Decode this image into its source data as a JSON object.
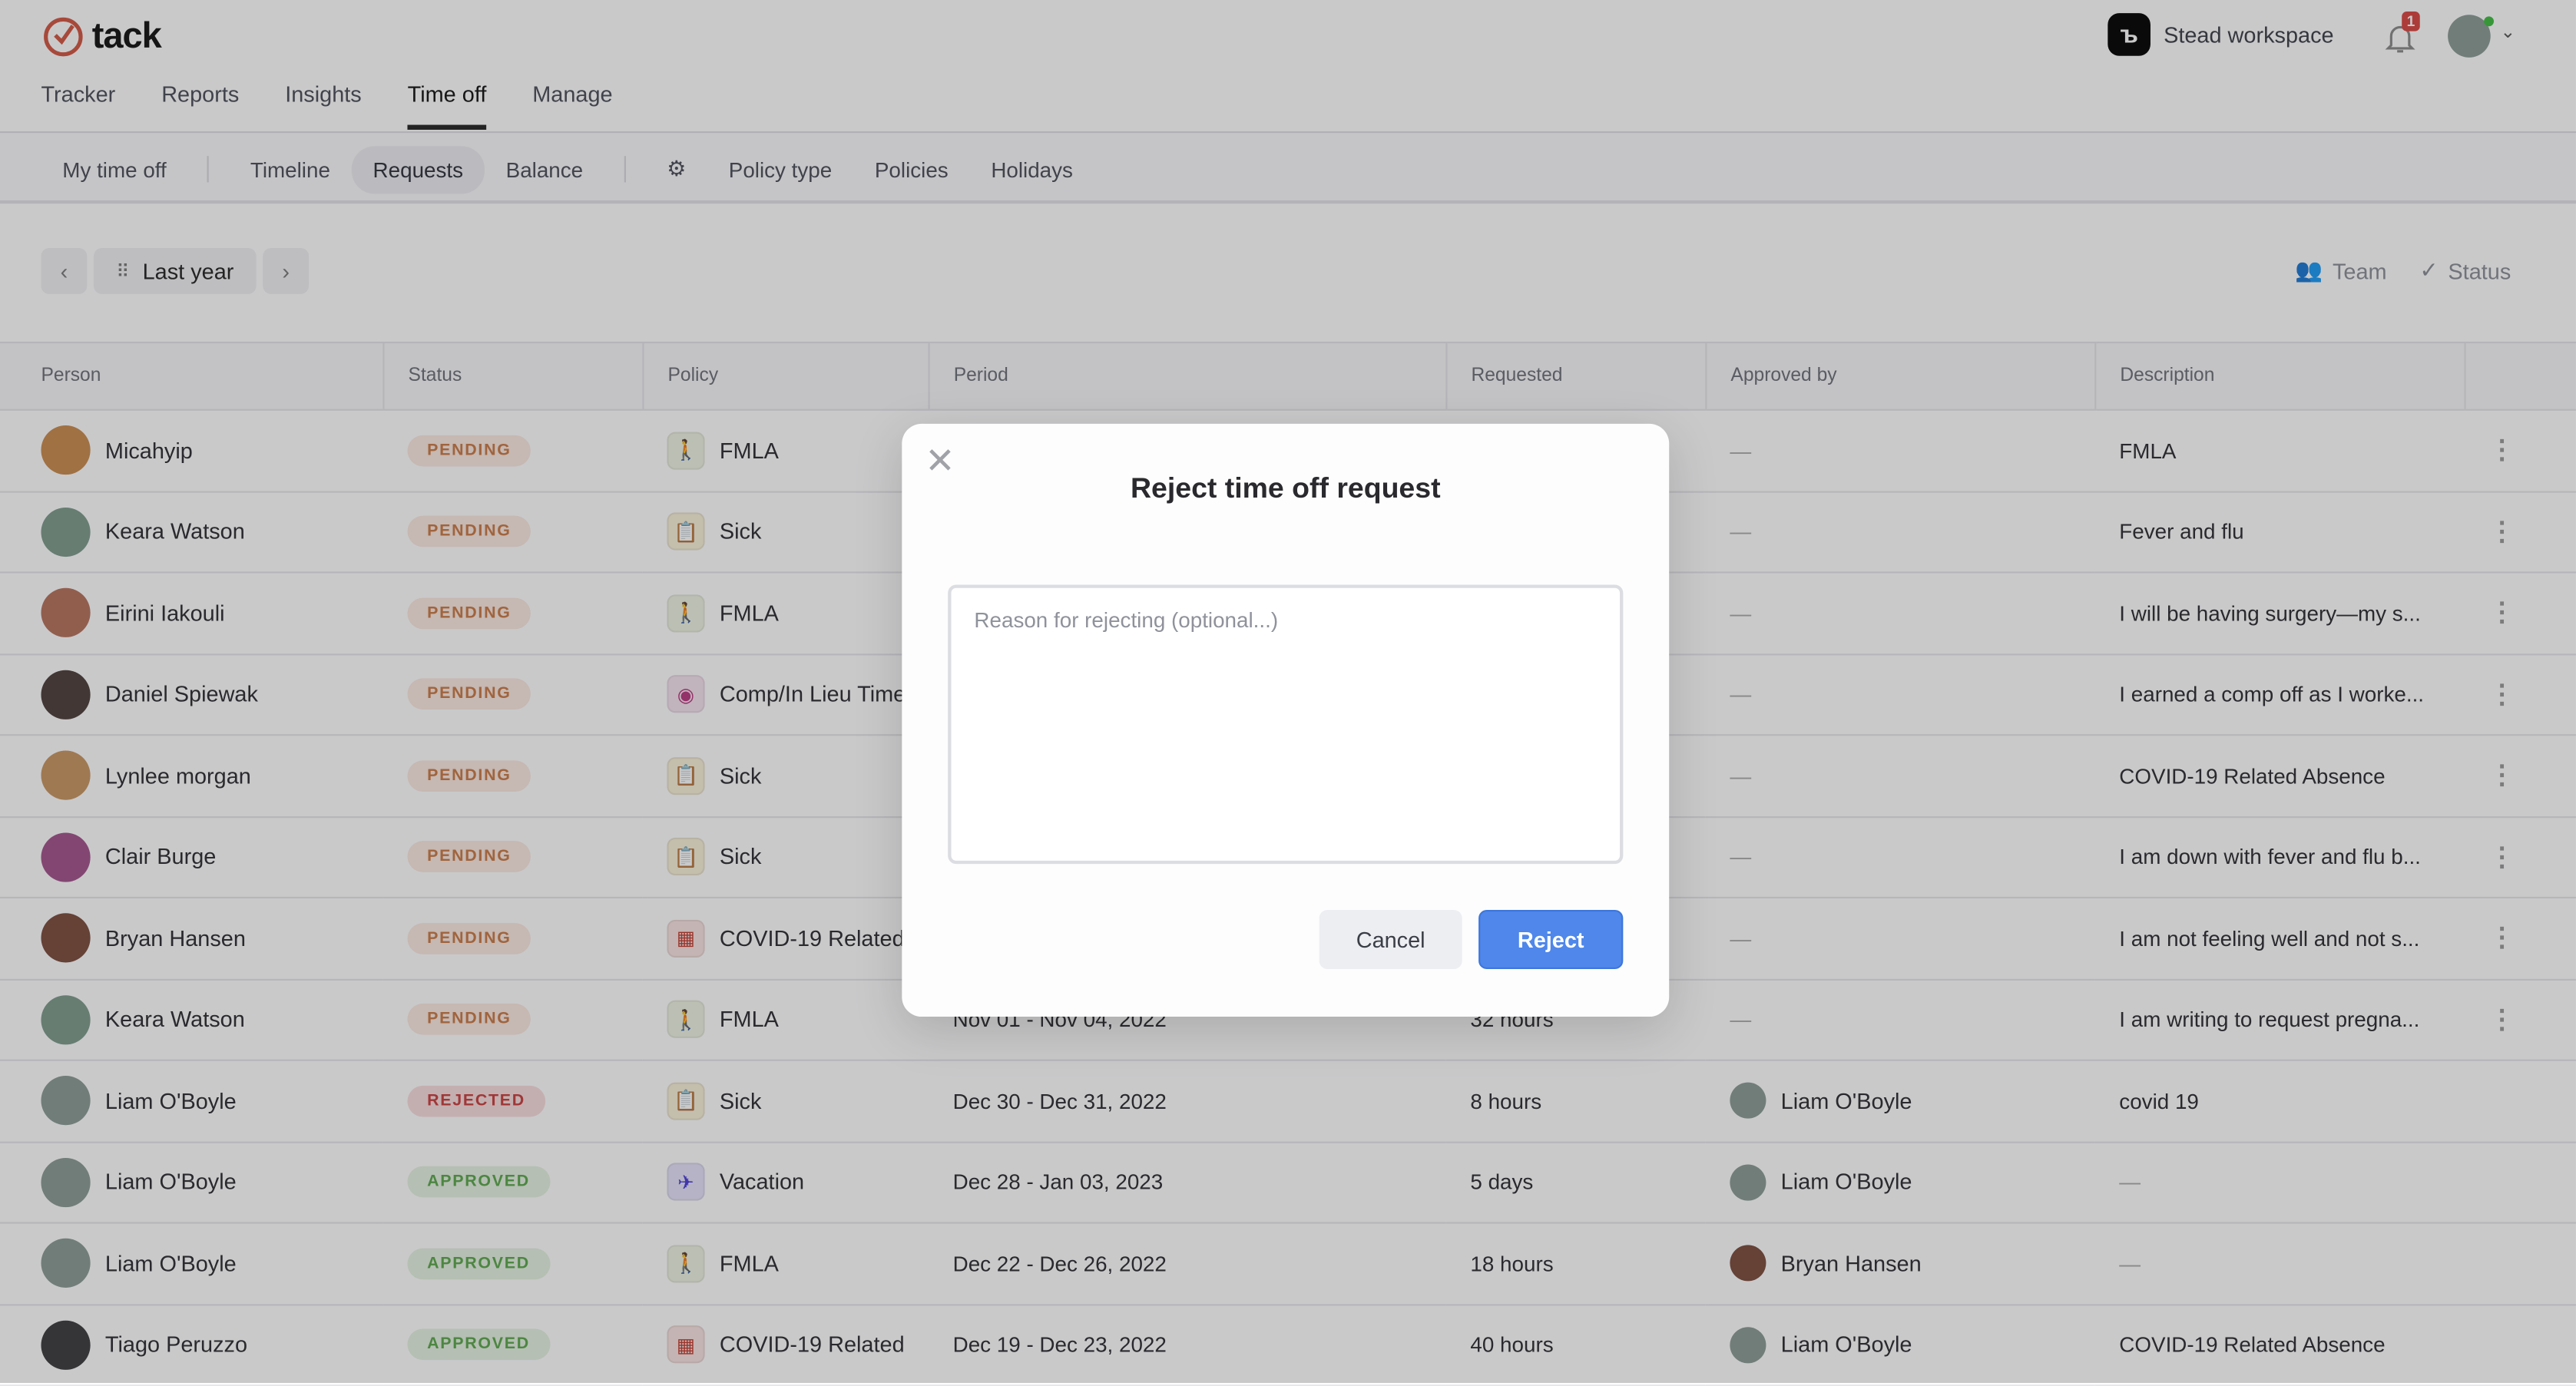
{
  "app": {
    "name": "tack",
    "workspace": "Stead workspace",
    "notifications": "1",
    "accent": "#4f87ea",
    "brand": "#d2553f"
  },
  "nav": [
    {
      "label": "Tracker"
    },
    {
      "label": "Reports"
    },
    {
      "label": "Insights"
    },
    {
      "label": "Time off",
      "active": true
    },
    {
      "label": "Manage"
    }
  ],
  "subnav": {
    "my_time_off": "My time off",
    "timeline": "Timeline",
    "requests": "Requests",
    "balance": "Balance",
    "policy_type": "Policy type",
    "policies": "Policies",
    "holidays": "Holidays"
  },
  "toolbar": {
    "range": "Last year",
    "team": "Team",
    "status": "Status"
  },
  "columns": [
    "Person",
    "Status",
    "Policy",
    "Period",
    "Requested",
    "Approved by",
    "Description"
  ],
  "rows": [
    {
      "person": "Micahyip",
      "avatar": "#c98a4b",
      "status": "PENDING",
      "policy": "FMLA",
      "policy_icon": "family-icon",
      "period": "",
      "requested": "",
      "approved_by": "—",
      "description": "FMLA",
      "menu": true
    },
    {
      "person": "Keara Watson",
      "avatar": "#7d9a8a",
      "status": "PENDING",
      "policy": "Sick",
      "policy_icon": "clipboard-medical-icon",
      "period": "",
      "requested": "",
      "approved_by": "—",
      "description": "Fever and flu",
      "menu": true
    },
    {
      "person": "Eirini Iakouli",
      "avatar": "#b4705a",
      "status": "PENDING",
      "policy": "FMLA",
      "policy_icon": "family-icon",
      "period": "",
      "requested": "",
      "approved_by": "—",
      "description": "I will be having surgery—my s...",
      "menu": true
    },
    {
      "person": "Daniel Spiewak",
      "avatar": "#4b3d38",
      "status": "PENDING",
      "policy": "Comp/In Lieu Time",
      "policy_icon": "film-reel-icon",
      "period": "",
      "requested": "",
      "approved_by": "—",
      "description": "I earned a comp off as I worke...",
      "menu": true
    },
    {
      "person": "Lynlee morgan",
      "avatar": "#c7955f",
      "status": "PENDING",
      "policy": "Sick",
      "policy_icon": "clipboard-medical-icon",
      "period": "",
      "requested": "",
      "approved_by": "—",
      "description": "COVID-19 Related Absence",
      "menu": true
    },
    {
      "person": "Clair Burge",
      "avatar": "#a2518a",
      "status": "PENDING",
      "policy": "Sick",
      "policy_icon": "clipboard-medical-icon",
      "period": "",
      "requested": "",
      "approved_by": "—",
      "description": "I am down with fever and flu b...",
      "menu": true
    },
    {
      "person": "Bryan Hansen",
      "avatar": "#7a4a3a",
      "status": "PENDING",
      "policy": "COVID-19 Related",
      "policy_icon": "storefront-icon",
      "period": "",
      "requested": "",
      "approved_by": "—",
      "description": "I am not feeling well and not s...",
      "menu": true
    },
    {
      "person": "Keara Watson",
      "avatar": "#7d9a8a",
      "status": "PENDING",
      "policy": "FMLA",
      "policy_icon": "family-icon",
      "period": "Nov 01 - Nov 04, 2022",
      "requested": "32 hours",
      "approved_by": "—",
      "description": "I am writing to request pregna...",
      "menu": true
    },
    {
      "person": "Liam O'Boyle",
      "avatar": "#8a9a93",
      "status": "REJECTED",
      "policy": "Sick",
      "policy_icon": "clipboard-medical-icon",
      "period": "Dec 30 - Dec 31, 2022",
      "requested": "8 hours",
      "approved_by": "Liam O'Boyle",
      "approver_avatar": "#8a9a93",
      "description": "covid 19",
      "menu": false
    },
    {
      "person": "Liam O'Boyle",
      "avatar": "#8a9a93",
      "status": "APPROVED",
      "policy": "Vacation",
      "policy_icon": "airplane-icon",
      "period": "Dec 28 - Jan 03, 2023",
      "requested": "5 days",
      "approved_by": "Liam O'Boyle",
      "approver_avatar": "#8a9a93",
      "description": "—",
      "menu": false
    },
    {
      "person": "Liam O'Boyle",
      "avatar": "#8a9a93",
      "status": "APPROVED",
      "policy": "FMLA",
      "policy_icon": "family-icon",
      "period": "Dec 22 - Dec 26, 2022",
      "requested": "18 hours",
      "approved_by": "Bryan Hansen",
      "approver_avatar": "#7a4a3a",
      "description": "—",
      "menu": false
    },
    {
      "person": "Tiago Peruzzo",
      "avatar": "#3a3a3c",
      "status": "APPROVED",
      "policy": "COVID-19 Related",
      "policy_icon": "storefront-icon",
      "period": "Dec 19 - Dec 23, 2022",
      "requested": "40 hours",
      "approved_by": "Liam O'Boyle",
      "approver_avatar": "#8a9a93",
      "description": "COVID-19 Related Absence",
      "menu": false
    }
  ],
  "modal": {
    "title": "Reject time off request",
    "placeholder": "Reason for rejecting (optional...)",
    "cancel": "Cancel",
    "reject": "Reject"
  }
}
